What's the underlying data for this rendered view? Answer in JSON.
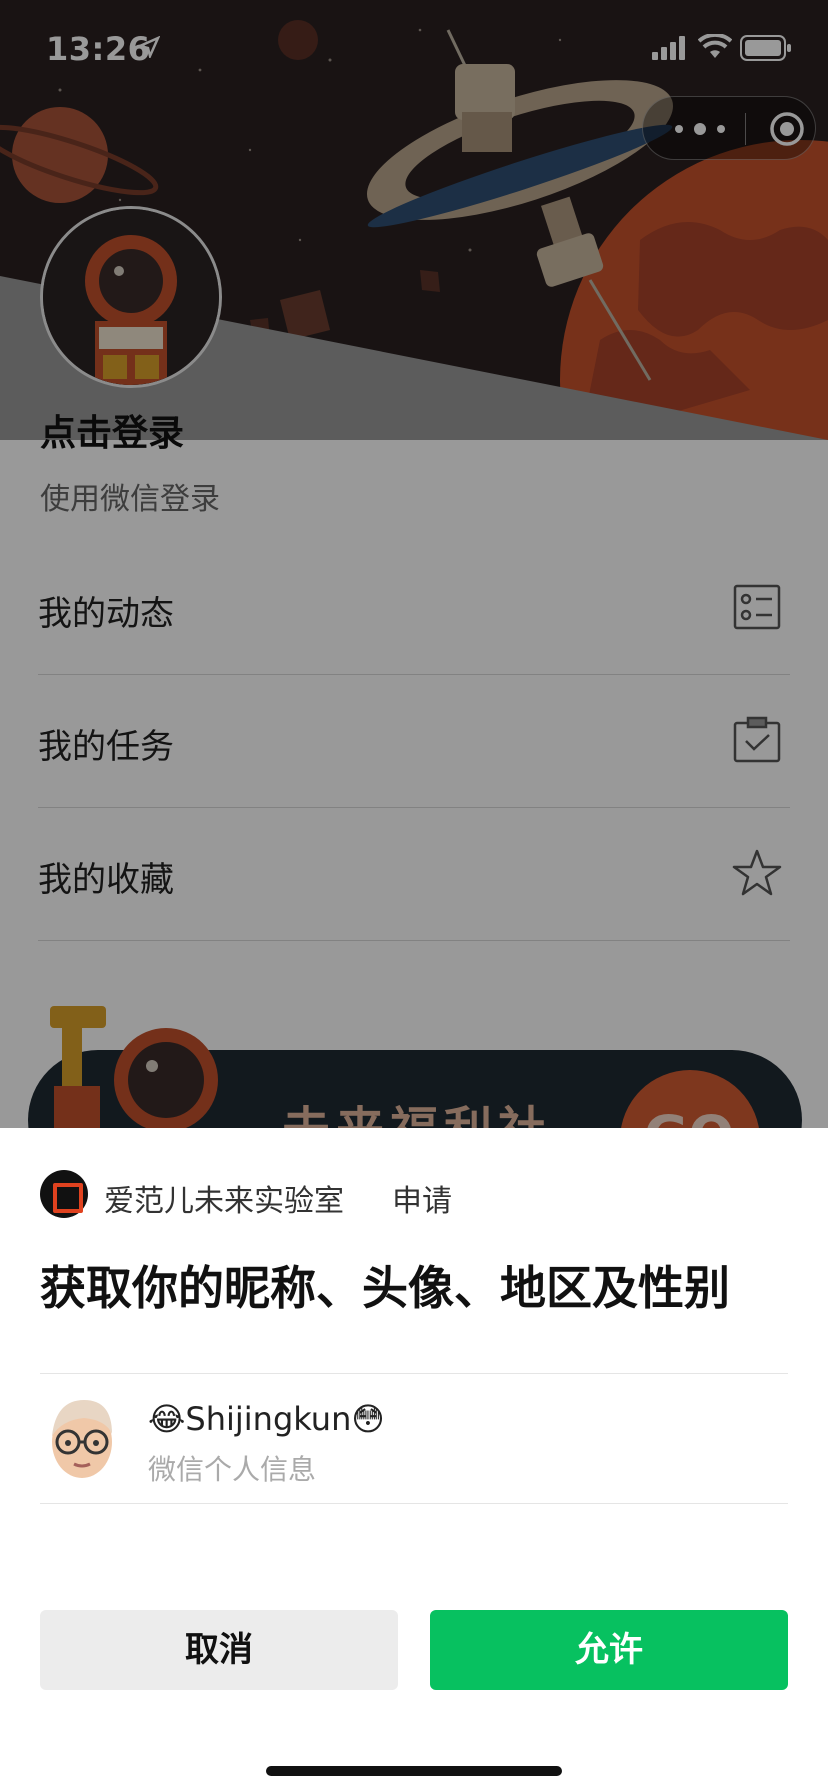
{
  "status_bar": {
    "time": "13:26"
  },
  "capsule": {
    "more_icon": "more-dots-icon",
    "close_icon": "target-close-icon"
  },
  "profile": {
    "login_title": "点击登录",
    "login_subtitle": "使用微信登录"
  },
  "menu": {
    "items": [
      {
        "label": "我的动态",
        "icon": "list-icon"
      },
      {
        "label": "我的任务",
        "icon": "clipboard-check-icon"
      },
      {
        "label": "我的收藏",
        "icon": "star-icon"
      }
    ]
  },
  "banner": {
    "title": "未来福利社",
    "go": "GO"
  },
  "auth_sheet": {
    "app_name": "爱范儿未来实验室",
    "apply": "申请",
    "title": "获取你的昵称、头像、地区及性别",
    "user_name": "😂Shijingkun😳",
    "user_subtitle": "微信个人信息",
    "cancel_label": "取消",
    "allow_label": "允许"
  },
  "colors": {
    "allow_green": "#07c160",
    "cancel_gray": "#ececec",
    "logo_red": "#e0421f",
    "mars_orange": "#c7532c"
  }
}
